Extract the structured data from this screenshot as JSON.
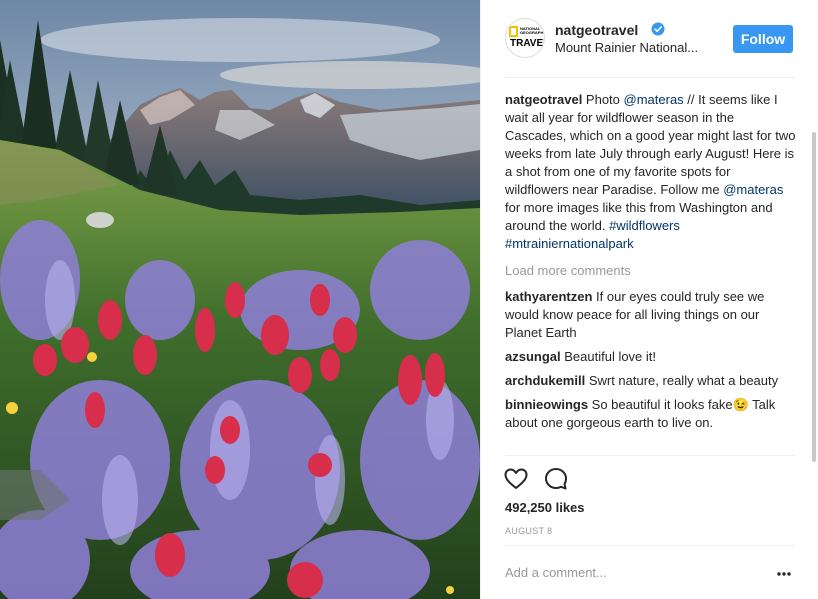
{
  "post": {
    "username": "natgeotravel",
    "location": "Mount Rainier National...",
    "follow_label": "Follow",
    "avatar": {
      "small_text": "NATIONAL GEOGRAPHIC",
      "big_text": "TRAVEL"
    },
    "caption": {
      "username": "natgeotravel",
      "t1": " Photo ",
      "mention1": "@materas",
      "t2": " // It seems like I wait all year for wildflower season in the Cascades, which on a good year might last for two weeks from late July through early August! Here is a shot from one of my favorite spots for wildflowers near Paradise. Follow me ",
      "mention2": "@materas",
      "t3": " for more images like this from Washington and around the world. ",
      "hashtag1": "#wildflowers",
      "t4": " ",
      "hashtag2": "#mtrainiernationalpark"
    },
    "load_more_label": "Load more comments",
    "comments": [
      {
        "username": "kathyarentzen",
        "text": " If our eyes could truly see we would know peace for all living things on our Planet Earth"
      },
      {
        "username": "azsungal",
        "text": " Beautiful love it!"
      },
      {
        "username": "archdukemill",
        "text": " Swrt nature, really what a beauty"
      },
      {
        "username": "binnieowings",
        "text": " So beautiful it looks fake😉 Talk about one gorgeous earth to live on."
      }
    ],
    "likes": "492,250 likes",
    "date": "AUGUST 8",
    "add_comment_placeholder": "Add a comment...",
    "icons": {
      "like": "heart-icon",
      "comment": "comment-icon",
      "more": "more-options-icon",
      "verified": "verified-badge-icon"
    },
    "colors": {
      "follow_button": "#3897f0",
      "link": "#003569",
      "muted": "#999999",
      "verified": "#3897f0"
    }
  }
}
